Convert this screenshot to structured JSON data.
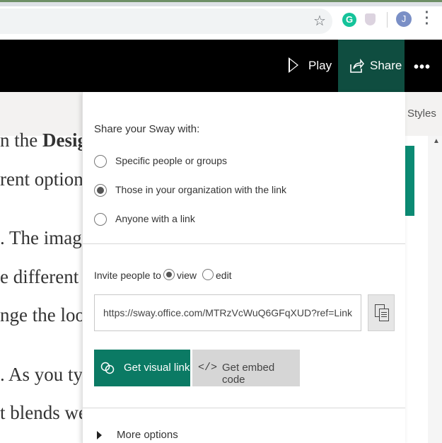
{
  "browser": {
    "avatar_letter": "J",
    "extension_letter": "G",
    "icons": [
      "star-icon",
      "grammarly-icon",
      "shield-icon",
      "avatar",
      "kebab-icon"
    ]
  },
  "appbar": {
    "play_label": "Play",
    "share_label": "Share",
    "more_label": "•••",
    "share_bg": "#0f4d40"
  },
  "background_doc": {
    "styles_label": "Styles",
    "lines": [
      {
        "text": "n the ",
        "bold": "Desig"
      },
      {
        "text": "rent option"
      },
      {
        "text": ". The image"
      },
      {
        "text": "e different l"
      },
      {
        "text": "nge the lool"
      },
      {
        "text": ". As you typ"
      },
      {
        "text": "t blends we"
      }
    ]
  },
  "share_panel": {
    "title": "Share your Sway with:",
    "audience_options": [
      {
        "label": "Specific people or groups",
        "selected": false
      },
      {
        "label": "Those in your organization with the link",
        "selected": true
      },
      {
        "label": "Anyone with a link",
        "selected": false
      }
    ],
    "invite_label": "Invite people to",
    "permission_options": [
      {
        "label": "view",
        "selected": true
      },
      {
        "label": "edit",
        "selected": false
      }
    ],
    "link_value": "https://sway.office.com/MTRzVcWuQ6GFqXUD?ref=Link",
    "visual_link_label": "Get visual link",
    "embed_code_label": "Get embed code",
    "embed_code_glyph": "</>",
    "more_options_label": "More options",
    "accent_color": "#0b7a64"
  }
}
